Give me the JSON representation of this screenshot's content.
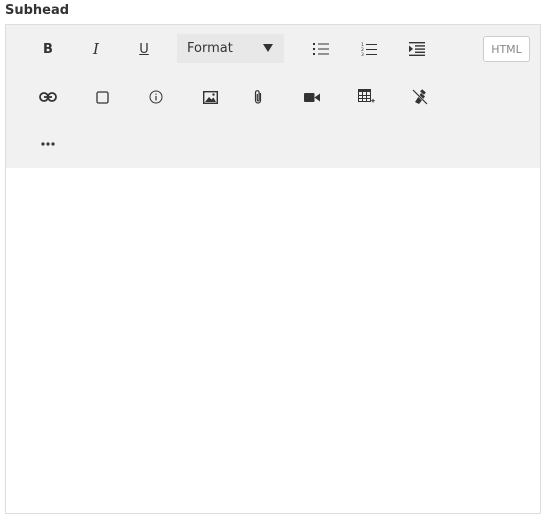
{
  "field": {
    "label": "Subhead"
  },
  "toolbar": {
    "bold": "B",
    "italic": "I",
    "underline": "U",
    "format_select": {
      "selected": "Format"
    },
    "html_button": "HTML",
    "icons": [
      "bold-icon",
      "italic-icon",
      "underline-icon",
      "bulleted-list-icon",
      "numbered-list-icon",
      "indent-icon",
      "link-icon",
      "box-icon",
      "info-icon",
      "image-icon",
      "attachment-icon",
      "video-icon",
      "table-icon",
      "clear-format-icon",
      "more-icon"
    ]
  },
  "editor": {
    "content": ""
  },
  "colors": {
    "toolbar_bg": "#f1f1f1",
    "select_bg": "#e8e8e8",
    "border": "#dddddd",
    "icon": "#333333",
    "html_text": "#888888"
  }
}
